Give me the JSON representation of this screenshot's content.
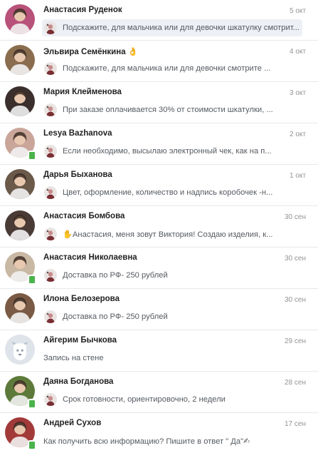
{
  "conversations": [
    {
      "name": "Анастасия Руденок",
      "date": "5 окт",
      "preview": "Подскажите, для мальчика или для девочки шкатулку смотрит...",
      "unread": true,
      "mini_avatar": true,
      "online": false,
      "avatar_color": "#b8527a"
    },
    {
      "name": "Эльвира Семёнкина 👌",
      "date": "4 окт",
      "preview": "Подскажите, для мальчика или для девочки смотрите ...",
      "unread": false,
      "mini_avatar": true,
      "online": false,
      "avatar_color": "#8a6d4f"
    },
    {
      "name": "Мария Клейменова",
      "date": "3 окт",
      "preview": "При заказе оплачивается 30% от стоимости шкатулки, ...",
      "unread": false,
      "mini_avatar": true,
      "online": false,
      "avatar_color": "#3a2f2c"
    },
    {
      "name": "Lesya Bazhanova",
      "date": "2 окт",
      "preview": "Если необходимо, высылаю электронный чек, как на п...",
      "unread": false,
      "mini_avatar": true,
      "online": true,
      "avatar_color": "#c9a59a"
    },
    {
      "name": "Дарья Быханова",
      "date": "1 окт",
      "preview": "Цвет, оформление, количество и надпись коробочек -н...",
      "unread": false,
      "mini_avatar": true,
      "online": false,
      "avatar_color": "#6b5a4a"
    },
    {
      "name": "Анастасия Бомбова",
      "date": "30 сен",
      "preview": "✋Анастасия, меня зовут Виктория! Создаю изделия, к...",
      "unread": false,
      "mini_avatar": true,
      "online": false,
      "avatar_color": "#4a3b36"
    },
    {
      "name": "Анастасия Николаевна",
      "date": "30 сен",
      "preview": "Доставка по РФ- 250 рублей",
      "unread": false,
      "mini_avatar": true,
      "online": true,
      "avatar_color": "#c8b8a4"
    },
    {
      "name": "Илона Белозерова",
      "date": "30 сен",
      "preview": "Доставка по РФ- 250 рублей",
      "unread": false,
      "mini_avatar": true,
      "online": false,
      "avatar_color": "#7a5a44"
    },
    {
      "name": "Айгерим Бычкова",
      "date": "29 сен",
      "preview": "Запись на стене",
      "unread": false,
      "mini_avatar": false,
      "online": false,
      "avatar_color": "#dfe3ea"
    },
    {
      "name": "Даяна Богданова",
      "date": "28 сен",
      "preview": "Срок готовности, ориентировочно, 2 недели",
      "unread": false,
      "mini_avatar": true,
      "online": true,
      "avatar_color": "#5d7a3a"
    },
    {
      "name": "Андрей Сухов",
      "date": "17 сен",
      "preview": "Как получить всю информацию? Пишите в ответ \" Да\"✍",
      "unread": false,
      "mini_avatar": false,
      "online": true,
      "avatar_color": "#a33a3a"
    }
  ],
  "colors": {
    "separator": "#e7e8ec",
    "unread_bg": "#edf0f5",
    "online": "#4bb34b",
    "name": "#222222",
    "date": "#939393",
    "preview": "#555a60"
  }
}
